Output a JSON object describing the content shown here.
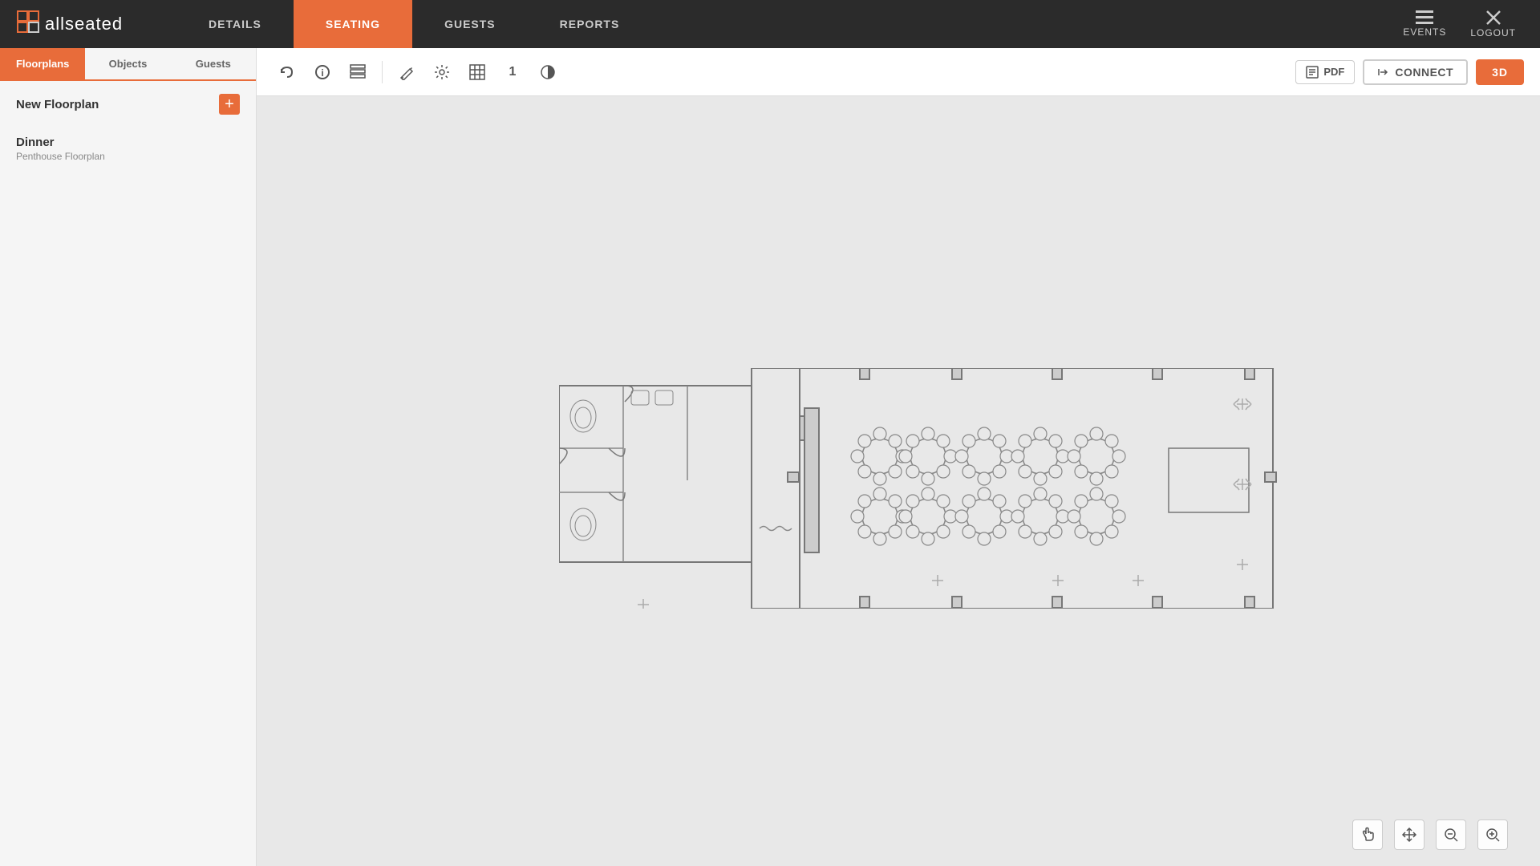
{
  "app": {
    "logo_icon": "⬛",
    "logo_text": "allseated"
  },
  "nav": {
    "items": [
      {
        "label": "DETAILS",
        "active": false
      },
      {
        "label": "SEATING",
        "active": true
      },
      {
        "label": "GUESTS",
        "active": false
      },
      {
        "label": "REPORTS",
        "active": false
      }
    ],
    "right": [
      {
        "label": "EVENTS",
        "icon": "≡"
      },
      {
        "label": "LOGOUT",
        "icon": "✕"
      }
    ]
  },
  "sidebar": {
    "tabs": [
      {
        "label": "Floorplans",
        "active": true
      },
      {
        "label": "Objects",
        "active": false
      },
      {
        "label": "Guests",
        "active": false
      }
    ],
    "new_floorplan_label": "New Floorplan",
    "new_floorplan_btn": "+",
    "floorplans": [
      {
        "name": "Dinner",
        "sub": "Penthouse Floorplan"
      }
    ]
  },
  "toolbar": {
    "pdf_label": "PDF",
    "connect_label": "CONNECT",
    "btn_3d_label": "3D"
  },
  "bottom_controls": {
    "hand_icon": "✋",
    "move_icon": "✛",
    "minus_icon": "−",
    "plus_icon": "+"
  }
}
